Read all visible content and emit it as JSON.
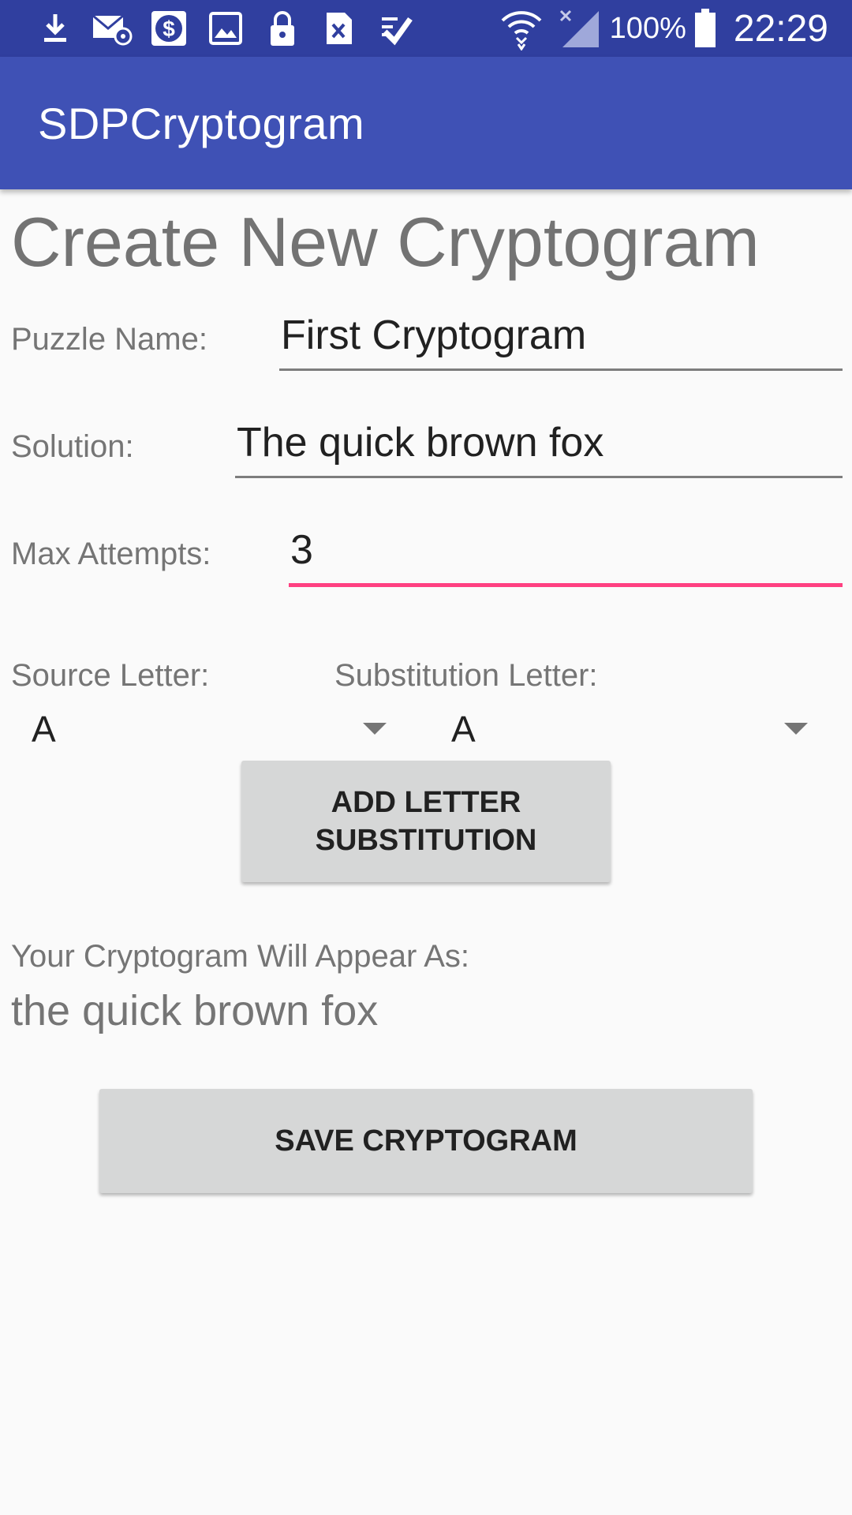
{
  "status_bar": {
    "icons": [
      "download-icon",
      "email-icon",
      "payment-icon",
      "image-icon",
      "lock-icon",
      "file-excel-icon",
      "tasks-icon"
    ],
    "battery": "100%",
    "time": "22:29"
  },
  "app_bar": {
    "title": "SDPCryptogram",
    "color": "#3f51b5",
    "status_color": "#303f9f"
  },
  "page": {
    "title": "Create New Cryptogram"
  },
  "form": {
    "puzzle_name_label": "Puzzle Name:",
    "puzzle_name_value": "First Cryptogram",
    "solution_label": "Solution:",
    "solution_value": "The quick brown fox",
    "max_attempts_label": "Max Attempts:",
    "max_attempts_value": "3",
    "source_letter_label": "Source Letter:",
    "source_letter_value": "A",
    "substitution_letter_label": "Substitution Letter:",
    "substitution_letter_value": "A",
    "add_substitution_button": "ADD LETTER SUBSTITUTION"
  },
  "preview": {
    "label": "Your Cryptogram Will Appear As:",
    "text": "the quick brown fox"
  },
  "save_button": "SAVE CRYPTOGRAM",
  "accent_color": "#ff4081"
}
